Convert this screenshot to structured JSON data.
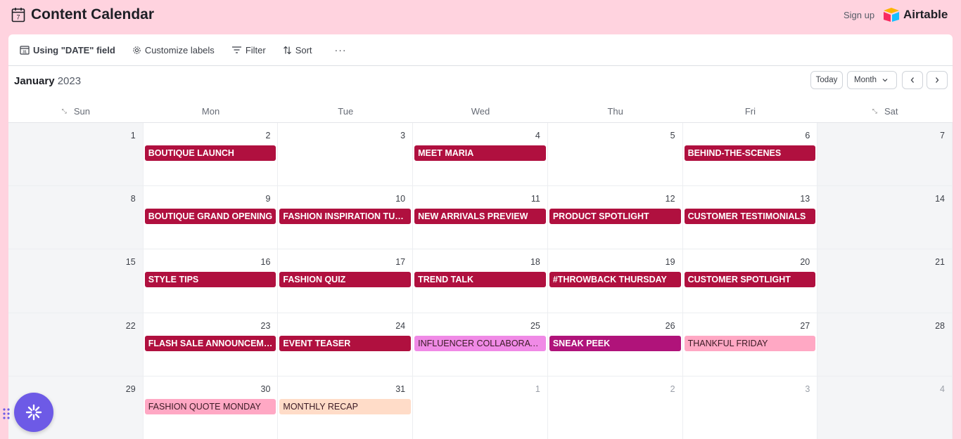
{
  "header": {
    "title": "Content Calendar",
    "signup": "Sign up",
    "brand": "Airtable"
  },
  "toolbar": {
    "date_field": "Using \"DATE\" field",
    "customize": "Customize labels",
    "filter": "Filter",
    "sort": "Sort",
    "more": "···"
  },
  "calendar": {
    "month": "January",
    "year": "2023",
    "today_label": "Today",
    "view_label": "Month",
    "days_of_week": [
      "Sun",
      "Mon",
      "Tue",
      "Wed",
      "Thu",
      "Fri",
      "Sat"
    ],
    "weeks": [
      [
        {
          "day": "1",
          "other": false
        },
        {
          "day": "2",
          "other": false,
          "event": "BOUTIQUE LAUNCH",
          "color": "#b0103f"
        },
        {
          "day": "3",
          "other": false
        },
        {
          "day": "4",
          "other": false,
          "event": "MEET MARIA",
          "color": "#b0103f"
        },
        {
          "day": "5",
          "other": false
        },
        {
          "day": "6",
          "other": false,
          "event": "BEHIND-THE-SCENES",
          "color": "#b0103f"
        },
        {
          "day": "7",
          "other": false
        }
      ],
      [
        {
          "day": "8",
          "other": false
        },
        {
          "day": "9",
          "other": false,
          "event": "BOUTIQUE GRAND OPENING",
          "color": "#b0103f"
        },
        {
          "day": "10",
          "other": false,
          "event": "FASHION INSPIRATION TUESDAY",
          "color": "#b0103f"
        },
        {
          "day": "11",
          "other": false,
          "event": "NEW ARRIVALS PREVIEW",
          "color": "#b0103f"
        },
        {
          "day": "12",
          "other": false,
          "event": "PRODUCT SPOTLIGHT",
          "color": "#b0103f"
        },
        {
          "day": "13",
          "other": false,
          "event": "CUSTOMER TESTIMONIALS",
          "color": "#b0103f"
        },
        {
          "day": "14",
          "other": false
        }
      ],
      [
        {
          "day": "15",
          "other": false
        },
        {
          "day": "16",
          "other": false,
          "event": "STYLE TIPS",
          "color": "#b0103f"
        },
        {
          "day": "17",
          "other": false,
          "event": "FASHION QUIZ",
          "color": "#b0103f"
        },
        {
          "day": "18",
          "other": false,
          "event": "TREND TALK",
          "color": "#b0103f"
        },
        {
          "day": "19",
          "other": false,
          "event": "#THROWBACK THURSDAY",
          "color": "#b0103f"
        },
        {
          "day": "20",
          "other": false,
          "event": "CUSTOMER SPOTLIGHT",
          "color": "#b0103f"
        },
        {
          "day": "21",
          "other": false
        }
      ],
      [
        {
          "day": "22",
          "other": false
        },
        {
          "day": "23",
          "other": false,
          "event": "FLASH SALE ANNOUNCEMENT",
          "color": "#b0103f"
        },
        {
          "day": "24",
          "other": false,
          "event": "EVENT TEASER",
          "color": "#b0103f"
        },
        {
          "day": "25",
          "other": false,
          "event": "INFLUENCER COLLABORATION",
          "color": "#f08ae6",
          "dark_text": true
        },
        {
          "day": "26",
          "other": false,
          "event": "SNEAK PEEK",
          "color": "#b0137a"
        },
        {
          "day": "27",
          "other": false,
          "event": "THANKFUL FRIDAY",
          "color": "#ffa8c4",
          "dark_text": true
        },
        {
          "day": "28",
          "other": false
        }
      ],
      [
        {
          "day": "29",
          "other": false
        },
        {
          "day": "30",
          "other": false,
          "event": "FASHION QUOTE MONDAY",
          "color": "#ffa8c4",
          "dark_text": true
        },
        {
          "day": "31",
          "other": false,
          "event": "MONTHLY RECAP",
          "color": "#ffdcc8",
          "dark_text": true
        },
        {
          "day": "1",
          "other": true
        },
        {
          "day": "2",
          "other": true
        },
        {
          "day": "3",
          "other": true
        },
        {
          "day": "4",
          "other": true
        }
      ]
    ]
  }
}
